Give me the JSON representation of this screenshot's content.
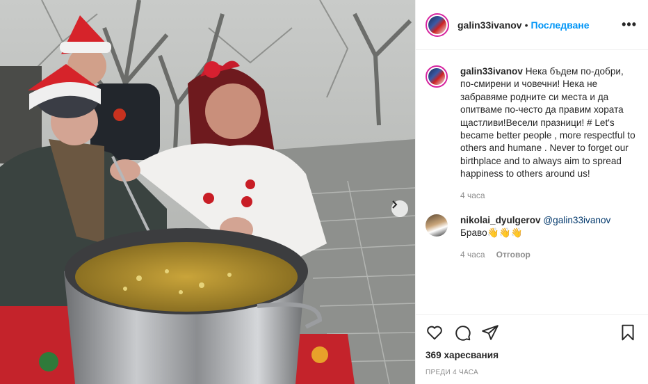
{
  "header": {
    "username": "galin33ivanov",
    "separator": "•",
    "follow_label": "Последване",
    "more_icon": "more-dots-icon"
  },
  "caption": {
    "username": "galin33ivanov",
    "text": "Нека бъдем по-добри, по-смирени и човечни! Нека не забравяме родните си места и да опитваме по-често да правим хората щастливи!Весели празници! # Let's became better people , more respectful to others and humane . Never to forget our birthplace and to always aim to spread happiness to others around us!",
    "time": "4 часа"
  },
  "comment": {
    "username": "nikolai_dyulgerov",
    "mention": "@galin33ivanov",
    "text": "Браво👋👋👋",
    "time": "4 часа",
    "reply_label": "Отговор"
  },
  "actions": {
    "like_icon": "heart-icon",
    "comment_icon": "comment-bubble-icon",
    "share_icon": "paper-plane-icon",
    "save_icon": "bookmark-icon",
    "likes_text": "369 харесвания",
    "posted_ago": "ПРЕДИ 4 ЧАСА"
  },
  "photo": {
    "next_icon": "chevron-right-icon"
  }
}
